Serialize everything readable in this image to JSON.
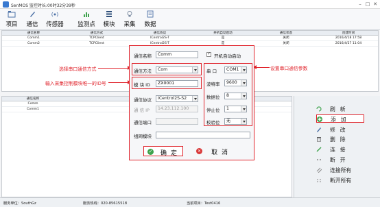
{
  "window": {
    "title": "SenMOS 监控时长:00时32分39秒"
  },
  "menu": [
    {
      "label": "项目",
      "icon": "folder-icon"
    },
    {
      "label": "通信",
      "icon": "pencil-icon"
    },
    {
      "label": "传感器",
      "icon": "sensor-icon"
    },
    {
      "label": "监测点",
      "icon": "chart-icon"
    },
    {
      "label": "模块",
      "icon": "module-icon"
    },
    {
      "label": "采集",
      "icon": "bulb-icon"
    },
    {
      "label": "数据",
      "icon": "data-icon"
    }
  ],
  "top_table": {
    "columns": [
      "通信名称",
      "通信方式",
      "通信协议",
      "开机自动启动",
      "通信状态",
      "创建时间"
    ],
    "rows": [
      [
        "Comm1",
        "TCPClient",
        "ICentrol2S-T",
        "是",
        "关闭",
        "2016/4/18 17:58"
      ],
      [
        "Comm2",
        "TCPClient",
        "ICentrol2S-T",
        "是",
        "关闭",
        "2016/4/27 11:04"
      ]
    ]
  },
  "bottom_table": {
    "columns": [
      "通信名称"
    ],
    "rows": [
      [
        "Comm"
      ],
      [
        "Comm1"
      ]
    ]
  },
  "dialog": {
    "comm_name_label": "通信名称",
    "comm_name_value": "Comm",
    "autostart_label": "开机自动启动",
    "comm_mode_label": "通信方法",
    "comm_mode_value": "Com",
    "module_id_label": "模 块 ID",
    "module_id_value": "ZX0001",
    "protocol_label": "通信协议",
    "protocol_value": "ICentrol2S-S2",
    "ip_label": "通 信 IP",
    "ip_value": "14.23.112.100",
    "port_label": "通信端口",
    "port_value": "",
    "group_label": "组网模块",
    "group_value": "",
    "serial_label": "串 口",
    "serial_value": "COM1",
    "baud_label": "波特率",
    "baud_value": "9600",
    "databits_label": "数据位",
    "databits_value": "8",
    "stopbits_label": "停止位",
    "stopbits_value": "1",
    "parity_label": "校验位",
    "parity_value": "无",
    "ok_label": "确定",
    "cancel_label": "取消"
  },
  "annotations": {
    "select_mode": "选择串口通信方式",
    "input_id": "输入采集控制模块唯一的ID号",
    "serial_params": "设置串口通信参数"
  },
  "actions": [
    {
      "label": "刷新",
      "icon": "refresh-icon"
    },
    {
      "label": "添加",
      "icon": "add-icon"
    },
    {
      "label": "修改",
      "icon": "edit-icon"
    },
    {
      "label": "删除",
      "icon": "delete-icon"
    },
    {
      "label": "连接",
      "icon": "connect-icon"
    },
    {
      "label": "断开",
      "icon": "disconnect-icon"
    },
    {
      "label": "连接所有",
      "icon": "connect-all-icon"
    },
    {
      "label": "断开所有",
      "icon": "disconnect-all-icon"
    }
  ],
  "status": {
    "unit": "服务单位：SouthGz",
    "phone": "服务热线：020-85615518",
    "project": "当前项目：Test0416"
  },
  "colors": {
    "accent": "#e0222a",
    "green": "#3fa34d",
    "red": "#d93a3a"
  }
}
